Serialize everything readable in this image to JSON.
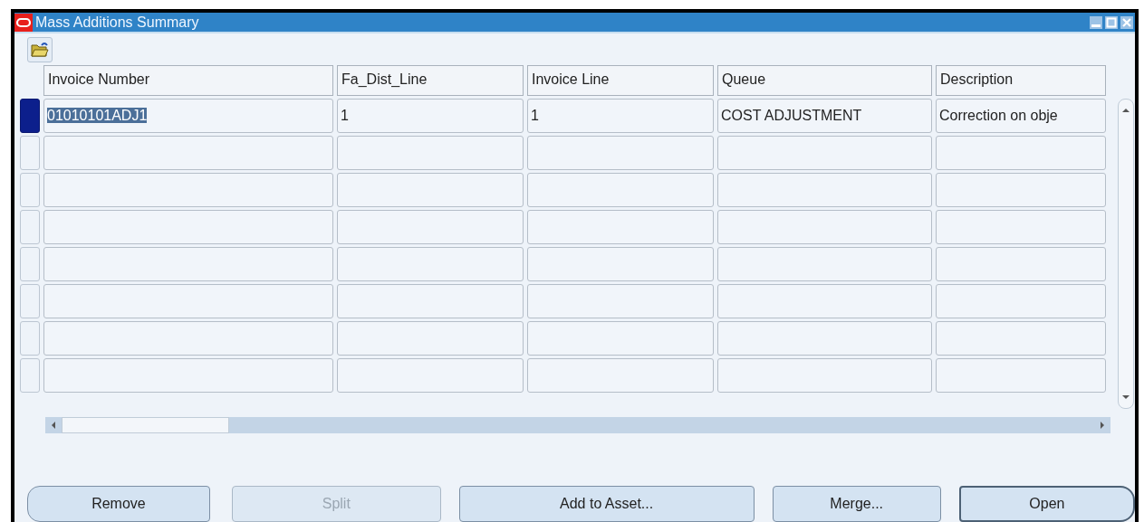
{
  "window": {
    "title": "Mass Additions Summary"
  },
  "table": {
    "columns": [
      "Invoice Number",
      "Fa_Dist_Line",
      "Invoice Line",
      "Queue",
      "Description"
    ],
    "rows": [
      {
        "selected": true,
        "cells": [
          "01010101ADJ1",
          "1",
          "1",
          "COST ADJUSTMENT",
          "Correction on obje"
        ]
      },
      {
        "selected": false
      },
      {
        "selected": false
      },
      {
        "selected": false
      },
      {
        "selected": false
      },
      {
        "selected": false
      },
      {
        "selected": false
      },
      {
        "selected": false
      }
    ]
  },
  "buttons": [
    {
      "label": "Remove",
      "disabled": false,
      "default": false
    },
    {
      "label": "Split",
      "disabled": true,
      "default": false
    },
    {
      "label": "Add to Asset...",
      "disabled": false,
      "default": false
    },
    {
      "label": "Merge...",
      "disabled": false,
      "default": false
    },
    {
      "label": "Open",
      "disabled": false,
      "default": true
    }
  ]
}
